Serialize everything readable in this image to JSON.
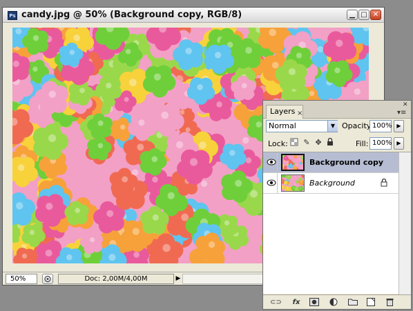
{
  "document": {
    "title": "candy.jpg @ 50% (Background copy, RGB/8)",
    "app_icon": "Ps",
    "controls": {
      "minimize": "▁",
      "maximize": "□",
      "close": "✕"
    }
  },
  "status": {
    "zoom": "50%",
    "info": "Doc: 2,00M/4,00M",
    "arrow": "▶"
  },
  "layers_panel": {
    "tab_label": "Layers",
    "tab_close": "×",
    "blend_mode": "Normal",
    "opacity_label": "Opacity:",
    "opacity_value": "100%",
    "lock_label": "Lock:",
    "fill_label": "Fill:",
    "fill_value": "100%",
    "layers": [
      {
        "name": "Background copy",
        "selected": true,
        "locked": false
      },
      {
        "name": "Background",
        "selected": false,
        "locked": true
      }
    ],
    "bottom_icons": [
      "link-icon",
      "fx-icon",
      "mask-icon",
      "adjustment-icon",
      "folder-icon",
      "new-layer-icon",
      "trash-icon"
    ],
    "fx_label": "fx"
  },
  "colors": {
    "candy": [
      "#f2a0c6",
      "#f7d23b",
      "#6fcf3a",
      "#5fc4ef",
      "#f06a52",
      "#f7a13a",
      "#e95a9c",
      "#9ad84b"
    ],
    "selected_row": "#b6bdd2"
  }
}
